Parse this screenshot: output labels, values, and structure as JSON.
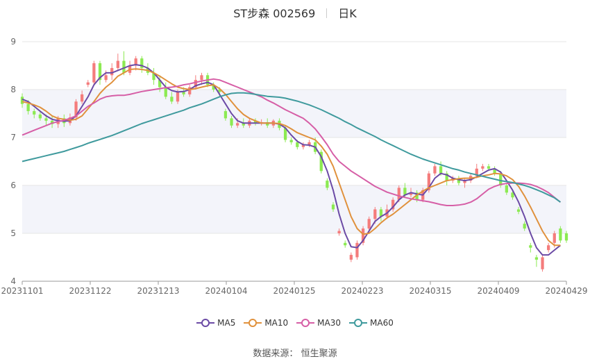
{
  "title": {
    "name": "ST步森 002569",
    "period": "日K"
  },
  "source": {
    "label": "数据来源：",
    "value": "恒生聚源"
  },
  "colors": {
    "up": "#f47c7c",
    "down": "#8cea52",
    "ma5": "#6b4aa5",
    "ma10": "#e0913c",
    "ma30": "#d65ea6",
    "ma60": "#3f9a9d",
    "grid": "#e6e6e6",
    "band": "#f3f4fa"
  },
  "chart_data": {
    "type": "candlestick",
    "y_ticks": [
      "4",
      "5",
      "6",
      "7",
      "8",
      "9"
    ],
    "ylim": [
      4,
      9
    ],
    "x_ticks": [
      "20231101",
      "20231122",
      "20231213",
      "20240104",
      "20240125",
      "20240223",
      "20240315",
      "20240409",
      "20240429"
    ],
    "legend": [
      "MA5",
      "MA10",
      "MA30",
      "MA60"
    ],
    "legend_position": "bottom",
    "candles_ohlc": [
      [
        7.85,
        7.7,
        7.92,
        7.62
      ],
      [
        7.7,
        7.55,
        7.78,
        7.48
      ],
      [
        7.55,
        7.48,
        7.6,
        7.4
      ],
      [
        7.48,
        7.4,
        7.55,
        7.35
      ],
      [
        7.4,
        7.35,
        7.48,
        7.25
      ],
      [
        7.35,
        7.28,
        7.45,
        7.2
      ],
      [
        7.28,
        7.4,
        7.45,
        7.2
      ],
      [
        7.4,
        7.3,
        7.48,
        7.22
      ],
      [
        7.3,
        7.42,
        7.5,
        7.25
      ],
      [
        7.42,
        7.75,
        7.8,
        7.35
      ],
      [
        7.75,
        7.9,
        7.98,
        7.7
      ],
      [
        8.1,
        8.15,
        8.2,
        8.05
      ],
      [
        8.15,
        8.55,
        8.6,
        8.1
      ],
      [
        8.55,
        8.2,
        8.6,
        8.1
      ],
      [
        8.2,
        8.3,
        8.4,
        8.15
      ],
      [
        8.3,
        8.45,
        8.55,
        8.2
      ],
      [
        8.45,
        8.6,
        8.75,
        8.4
      ],
      [
        8.6,
        8.35,
        8.8,
        8.3
      ],
      [
        8.35,
        8.5,
        8.6,
        8.3
      ],
      [
        8.5,
        8.65,
        8.7,
        8.4
      ],
      [
        8.65,
        8.45,
        8.7,
        8.35
      ],
      [
        8.45,
        8.35,
        8.55,
        8.3
      ],
      [
        8.35,
        8.2,
        8.45,
        8.1
      ],
      [
        8.2,
        8.05,
        8.3,
        7.95
      ],
      [
        8.05,
        7.85,
        8.15,
        7.8
      ],
      [
        7.85,
        7.75,
        7.95,
        7.7
      ],
      [
        7.75,
        7.95,
        8.0,
        7.7
      ],
      [
        7.95,
        7.9,
        8.05,
        7.85
      ],
      [
        7.9,
        8.05,
        8.1,
        7.85
      ],
      [
        8.05,
        8.2,
        8.3,
        8.0
      ],
      [
        8.2,
        8.3,
        8.35,
        8.1
      ],
      [
        8.3,
        8.1,
        8.35,
        8.05
      ],
      [
        8.1,
        8.0,
        8.15,
        7.95
      ],
      [
        8.0,
        7.95,
        8.05,
        7.85
      ],
      [
        7.55,
        7.4,
        7.6,
        7.35
      ],
      [
        7.4,
        7.25,
        7.45,
        7.2
      ],
      [
        7.25,
        7.3,
        7.4,
        7.2
      ],
      [
        7.3,
        7.25,
        7.4,
        7.2
      ],
      [
        7.25,
        7.35,
        7.4,
        7.2
      ],
      [
        7.35,
        7.3,
        7.4,
        7.25
      ],
      [
        7.3,
        7.32,
        7.38,
        7.25
      ],
      [
        7.32,
        7.25,
        7.4,
        7.2
      ],
      [
        7.25,
        7.35,
        7.38,
        7.2
      ],
      [
        7.35,
        7.2,
        7.4,
        7.15
      ],
      [
        7.2,
        6.95,
        7.25,
        6.9
      ],
      [
        6.95,
        6.9,
        7.0,
        6.85
      ],
      [
        6.9,
        6.8,
        6.95,
        6.75
      ],
      [
        6.8,
        6.85,
        6.9,
        6.75
      ],
      [
        6.85,
        6.9,
        6.95,
        6.8
      ],
      [
        6.9,
        6.7,
        7.0,
        6.65
      ],
      [
        6.7,
        6.3,
        6.75,
        6.25
      ],
      [
        6.1,
        5.95,
        6.15,
        5.9
      ],
      [
        5.6,
        5.5,
        5.65,
        5.45
      ],
      [
        5.0,
        5.05,
        5.1,
        4.95
      ],
      [
        4.8,
        4.75,
        4.85,
        4.7
      ],
      [
        4.45,
        4.55,
        4.6,
        4.4
      ],
      [
        4.5,
        4.8,
        4.85,
        4.45
      ],
      [
        4.8,
        5.1,
        5.15,
        4.75
      ],
      [
        5.1,
        5.3,
        5.35,
        5.0
      ],
      [
        5.3,
        5.5,
        5.55,
        5.2
      ],
      [
        5.5,
        5.35,
        5.55,
        5.25
      ],
      [
        5.35,
        5.5,
        5.6,
        5.3
      ],
      [
        5.5,
        5.7,
        5.75,
        5.45
      ],
      [
        5.7,
        5.95,
        6.0,
        5.65
      ],
      [
        5.95,
        5.8,
        6.05,
        5.75
      ],
      [
        5.8,
        5.85,
        5.95,
        5.75
      ],
      [
        5.85,
        5.7,
        5.9,
        5.65
      ],
      [
        5.7,
        5.9,
        5.95,
        5.65
      ],
      [
        5.9,
        6.25,
        6.3,
        5.85
      ],
      [
        6.25,
        6.4,
        6.45,
        6.2
      ],
      [
        6.4,
        6.25,
        6.5,
        6.2
      ],
      [
        6.25,
        6.1,
        6.3,
        6.0
      ],
      [
        6.1,
        6.15,
        6.2,
        6.05
      ],
      [
        6.15,
        6.05,
        6.2,
        6.0
      ],
      [
        6.05,
        6.1,
        6.15,
        5.95
      ],
      [
        6.1,
        6.2,
        6.25,
        6.05
      ],
      [
        6.2,
        6.35,
        6.45,
        6.15
      ],
      [
        6.35,
        6.4,
        6.45,
        6.3
      ],
      [
        6.4,
        6.35,
        6.45,
        6.3
      ],
      [
        6.35,
        6.25,
        6.4,
        6.2
      ],
      [
        6.25,
        6.0,
        6.3,
        5.95
      ],
      [
        6.0,
        5.85,
        6.05,
        5.8
      ],
      [
        5.85,
        5.75,
        5.9,
        5.7
      ],
      [
        5.5,
        5.45,
        5.55,
        5.4
      ],
      [
        5.2,
        5.1,
        5.25,
        5.05
      ],
      [
        4.75,
        4.7,
        4.8,
        4.6
      ],
      [
        4.5,
        4.45,
        4.55,
        4.3
      ],
      [
        4.25,
        4.5,
        4.55,
        4.2
      ],
      [
        4.65,
        4.75,
        4.8,
        4.6
      ],
      [
        4.8,
        5.0,
        5.05,
        4.7
      ],
      [
        5.1,
        4.85,
        5.15,
        4.8
      ],
      [
        5.0,
        4.85,
        5.05,
        4.8
      ]
    ],
    "series": [
      {
        "name": "MA5",
        "values": [
          7.8,
          7.75,
          7.65,
          7.55,
          7.45,
          7.38,
          7.35,
          7.34,
          7.35,
          7.45,
          7.65,
          7.85,
          8.1,
          8.25,
          8.35,
          8.35,
          8.4,
          8.45,
          8.5,
          8.52,
          8.5,
          8.45,
          8.35,
          8.2,
          8.05,
          7.98,
          7.95,
          7.96,
          8.0,
          8.08,
          8.12,
          8.15,
          8.1,
          7.9,
          7.7,
          7.5,
          7.35,
          7.3,
          7.3,
          7.3,
          7.3,
          7.3,
          7.3,
          7.28,
          7.2,
          7.05,
          6.92,
          6.85,
          6.84,
          6.8,
          6.6,
          6.3,
          5.9,
          5.4,
          5.0,
          4.72,
          4.7,
          4.85,
          5.05,
          5.25,
          5.35,
          5.42,
          5.55,
          5.7,
          5.8,
          5.85,
          5.82,
          5.8,
          5.95,
          6.15,
          6.25,
          6.22,
          6.15,
          6.12,
          6.1,
          6.12,
          6.18,
          6.25,
          6.32,
          6.35,
          6.28,
          6.1,
          5.9,
          5.65,
          5.35,
          5.0,
          4.7,
          4.55,
          4.55,
          4.65,
          4.75
        ]
      },
      {
        "name": "MA10",
        "values": [
          7.75,
          7.72,
          7.68,
          7.63,
          7.55,
          7.45,
          7.4,
          7.38,
          7.36,
          7.38,
          7.45,
          7.6,
          7.75,
          7.92,
          8.05,
          8.15,
          8.28,
          8.35,
          8.42,
          8.43,
          8.42,
          8.4,
          8.35,
          8.28,
          8.2,
          8.12,
          8.05,
          8.02,
          8.0,
          8.02,
          8.05,
          8.08,
          8.1,
          8.02,
          7.9,
          7.75,
          7.6,
          7.48,
          7.4,
          7.35,
          7.3,
          7.3,
          7.3,
          7.29,
          7.25,
          7.18,
          7.1,
          7.05,
          7.0,
          6.95,
          6.82,
          6.65,
          6.4,
          6.05,
          5.7,
          5.35,
          5.1,
          4.98,
          5.0,
          5.1,
          5.22,
          5.32,
          5.4,
          5.5,
          5.6,
          5.7,
          5.8,
          5.88,
          5.95,
          6.0,
          6.05,
          6.1,
          6.12,
          6.14,
          6.15,
          6.15,
          6.17,
          6.2,
          6.22,
          6.25,
          6.24,
          6.2,
          6.12,
          5.98,
          5.78,
          5.55,
          5.3,
          5.05,
          4.85,
          4.75,
          4.75
        ]
      },
      {
        "name": "MA30",
        "values": [
          7.05,
          7.1,
          7.15,
          7.2,
          7.25,
          7.3,
          7.33,
          7.36,
          7.4,
          7.45,
          7.55,
          7.65,
          7.72,
          7.8,
          7.85,
          7.87,
          7.88,
          7.88,
          7.9,
          7.93,
          7.96,
          7.98,
          8.0,
          8.02,
          8.04,
          8.05,
          8.07,
          8.1,
          8.12,
          8.15,
          8.18,
          8.2,
          8.22,
          8.2,
          8.15,
          8.1,
          8.05,
          8.0,
          7.95,
          7.9,
          7.85,
          7.78,
          7.72,
          7.65,
          7.58,
          7.52,
          7.46,
          7.4,
          7.3,
          7.18,
          7.02,
          6.85,
          6.65,
          6.5,
          6.4,
          6.3,
          6.22,
          6.14,
          6.06,
          5.98,
          5.92,
          5.86,
          5.82,
          5.78,
          5.75,
          5.72,
          5.7,
          5.68,
          5.66,
          5.63,
          5.6,
          5.58,
          5.58,
          5.59,
          5.61,
          5.65,
          5.72,
          5.82,
          5.92,
          5.98,
          6.02,
          6.04,
          6.05,
          6.05,
          6.04,
          6.02,
          5.98,
          5.92,
          5.85,
          5.75,
          5.65
        ]
      },
      {
        "name": "MA60",
        "values": [
          6.5,
          6.53,
          6.56,
          6.59,
          6.62,
          6.65,
          6.68,
          6.71,
          6.75,
          6.79,
          6.83,
          6.88,
          6.92,
          6.96,
          7.0,
          7.04,
          7.09,
          7.14,
          7.19,
          7.24,
          7.29,
          7.33,
          7.37,
          7.41,
          7.45,
          7.49,
          7.53,
          7.57,
          7.62,
          7.66,
          7.7,
          7.75,
          7.8,
          7.85,
          7.89,
          7.92,
          7.93,
          7.93,
          7.92,
          7.9,
          7.88,
          7.86,
          7.85,
          7.84,
          7.82,
          7.79,
          7.76,
          7.72,
          7.68,
          7.63,
          7.58,
          7.52,
          7.46,
          7.4,
          7.33,
          7.27,
          7.2,
          7.14,
          7.08,
          7.02,
          6.95,
          6.89,
          6.83,
          6.77,
          6.71,
          6.65,
          6.6,
          6.55,
          6.51,
          6.47,
          6.43,
          6.39,
          6.35,
          6.32,
          6.28,
          6.25,
          6.22,
          6.19,
          6.16,
          6.13,
          6.1,
          6.08,
          6.06,
          6.03,
          6.0,
          5.96,
          5.91,
          5.86,
          5.8,
          5.74,
          5.65
        ]
      }
    ]
  }
}
